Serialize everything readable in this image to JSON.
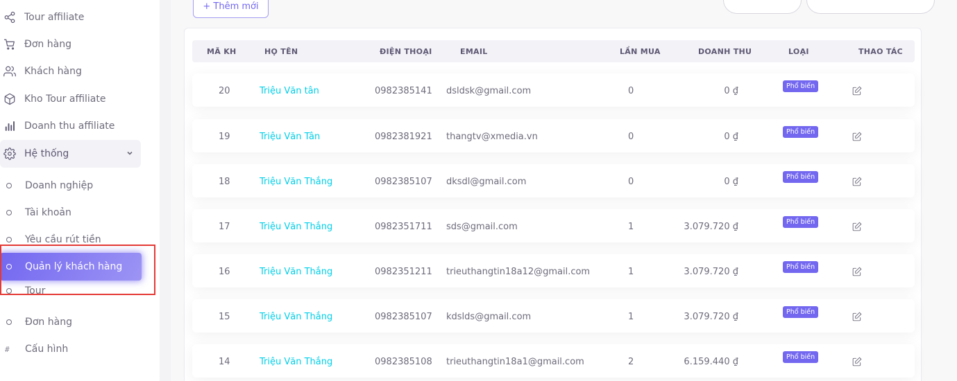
{
  "sidebar": {
    "items": [
      {
        "label": "Tour affiliate",
        "icon": "share-icon"
      },
      {
        "label": "Đơn hàng",
        "icon": "cart-icon"
      },
      {
        "label": "Khách hàng",
        "icon": "users-icon"
      },
      {
        "label": "Kho Tour affiliate",
        "icon": "package-icon"
      },
      {
        "label": "Doanh thu affiliate",
        "icon": "bar-chart-icon"
      }
    ],
    "group": {
      "label": "Hệ thống",
      "icon": "settings-icon"
    },
    "subitems": [
      {
        "label": "Doanh nghiệp"
      },
      {
        "label": "Tài khoản"
      },
      {
        "label": "Yêu cầu rút tiền"
      },
      {
        "label": "Quản lý khách hàng"
      },
      {
        "label": "Tour"
      },
      {
        "label": "Đơn hàng"
      },
      {
        "label": "Cấu hình"
      }
    ]
  },
  "toolbar": {
    "add_label": "+ Thêm mới"
  },
  "table": {
    "headers": [
      "MÃ KH",
      "HỌ TÊN",
      "ĐIỆN THOẠI",
      "EMAIL",
      "LẦN MUA",
      "DOANH THU",
      "LOẠI",
      "THAO TÁC"
    ],
    "rows": [
      {
        "id": "20",
        "name": "Triệu Văn tân",
        "phone": "0982385141",
        "email": "dsldsk@gmail.com",
        "purchases": "0",
        "revenue": "0 ₫",
        "type": "Phổ biến"
      },
      {
        "id": "19",
        "name": "Triệu Văn Tân",
        "phone": "0982381921",
        "email": "thangtv@xmedia.vn",
        "purchases": "0",
        "revenue": "0 ₫",
        "type": "Phổ biến"
      },
      {
        "id": "18",
        "name": "Triệu Văn Thắng",
        "phone": "0982385107",
        "email": "dksdl@gmail.com",
        "purchases": "0",
        "revenue": "0 ₫",
        "type": "Phổ biến"
      },
      {
        "id": "17",
        "name": "Triệu Văn Thắng",
        "phone": "0982351711",
        "email": "sds@gmail.com",
        "purchases": "1",
        "revenue": "3.079.720 ₫",
        "type": "Phổ biến"
      },
      {
        "id": "16",
        "name": "Triệu Văn Thắng",
        "phone": "0982351211",
        "email": "trieuthangtin18a12@gmail.com",
        "purchases": "1",
        "revenue": "3.079.720 ₫",
        "type": "Phổ biến"
      },
      {
        "id": "15",
        "name": "Triệu Văn Thắng",
        "phone": "0982385107",
        "email": "kdslds@gmail.com",
        "purchases": "1",
        "revenue": "3.079.720 ₫",
        "type": "Phổ biến"
      },
      {
        "id": "14",
        "name": "Triệu Văn Thắng",
        "phone": "0982385108",
        "email": "trieuthangtin18a1@gmail.com",
        "purchases": "2",
        "revenue": "6.159.440 ₫",
        "type": "Phổ biến"
      }
    ]
  },
  "colors": {
    "accent": "#7367f0",
    "name_link": "#00cfe8",
    "highlight_border": "#e53935"
  }
}
